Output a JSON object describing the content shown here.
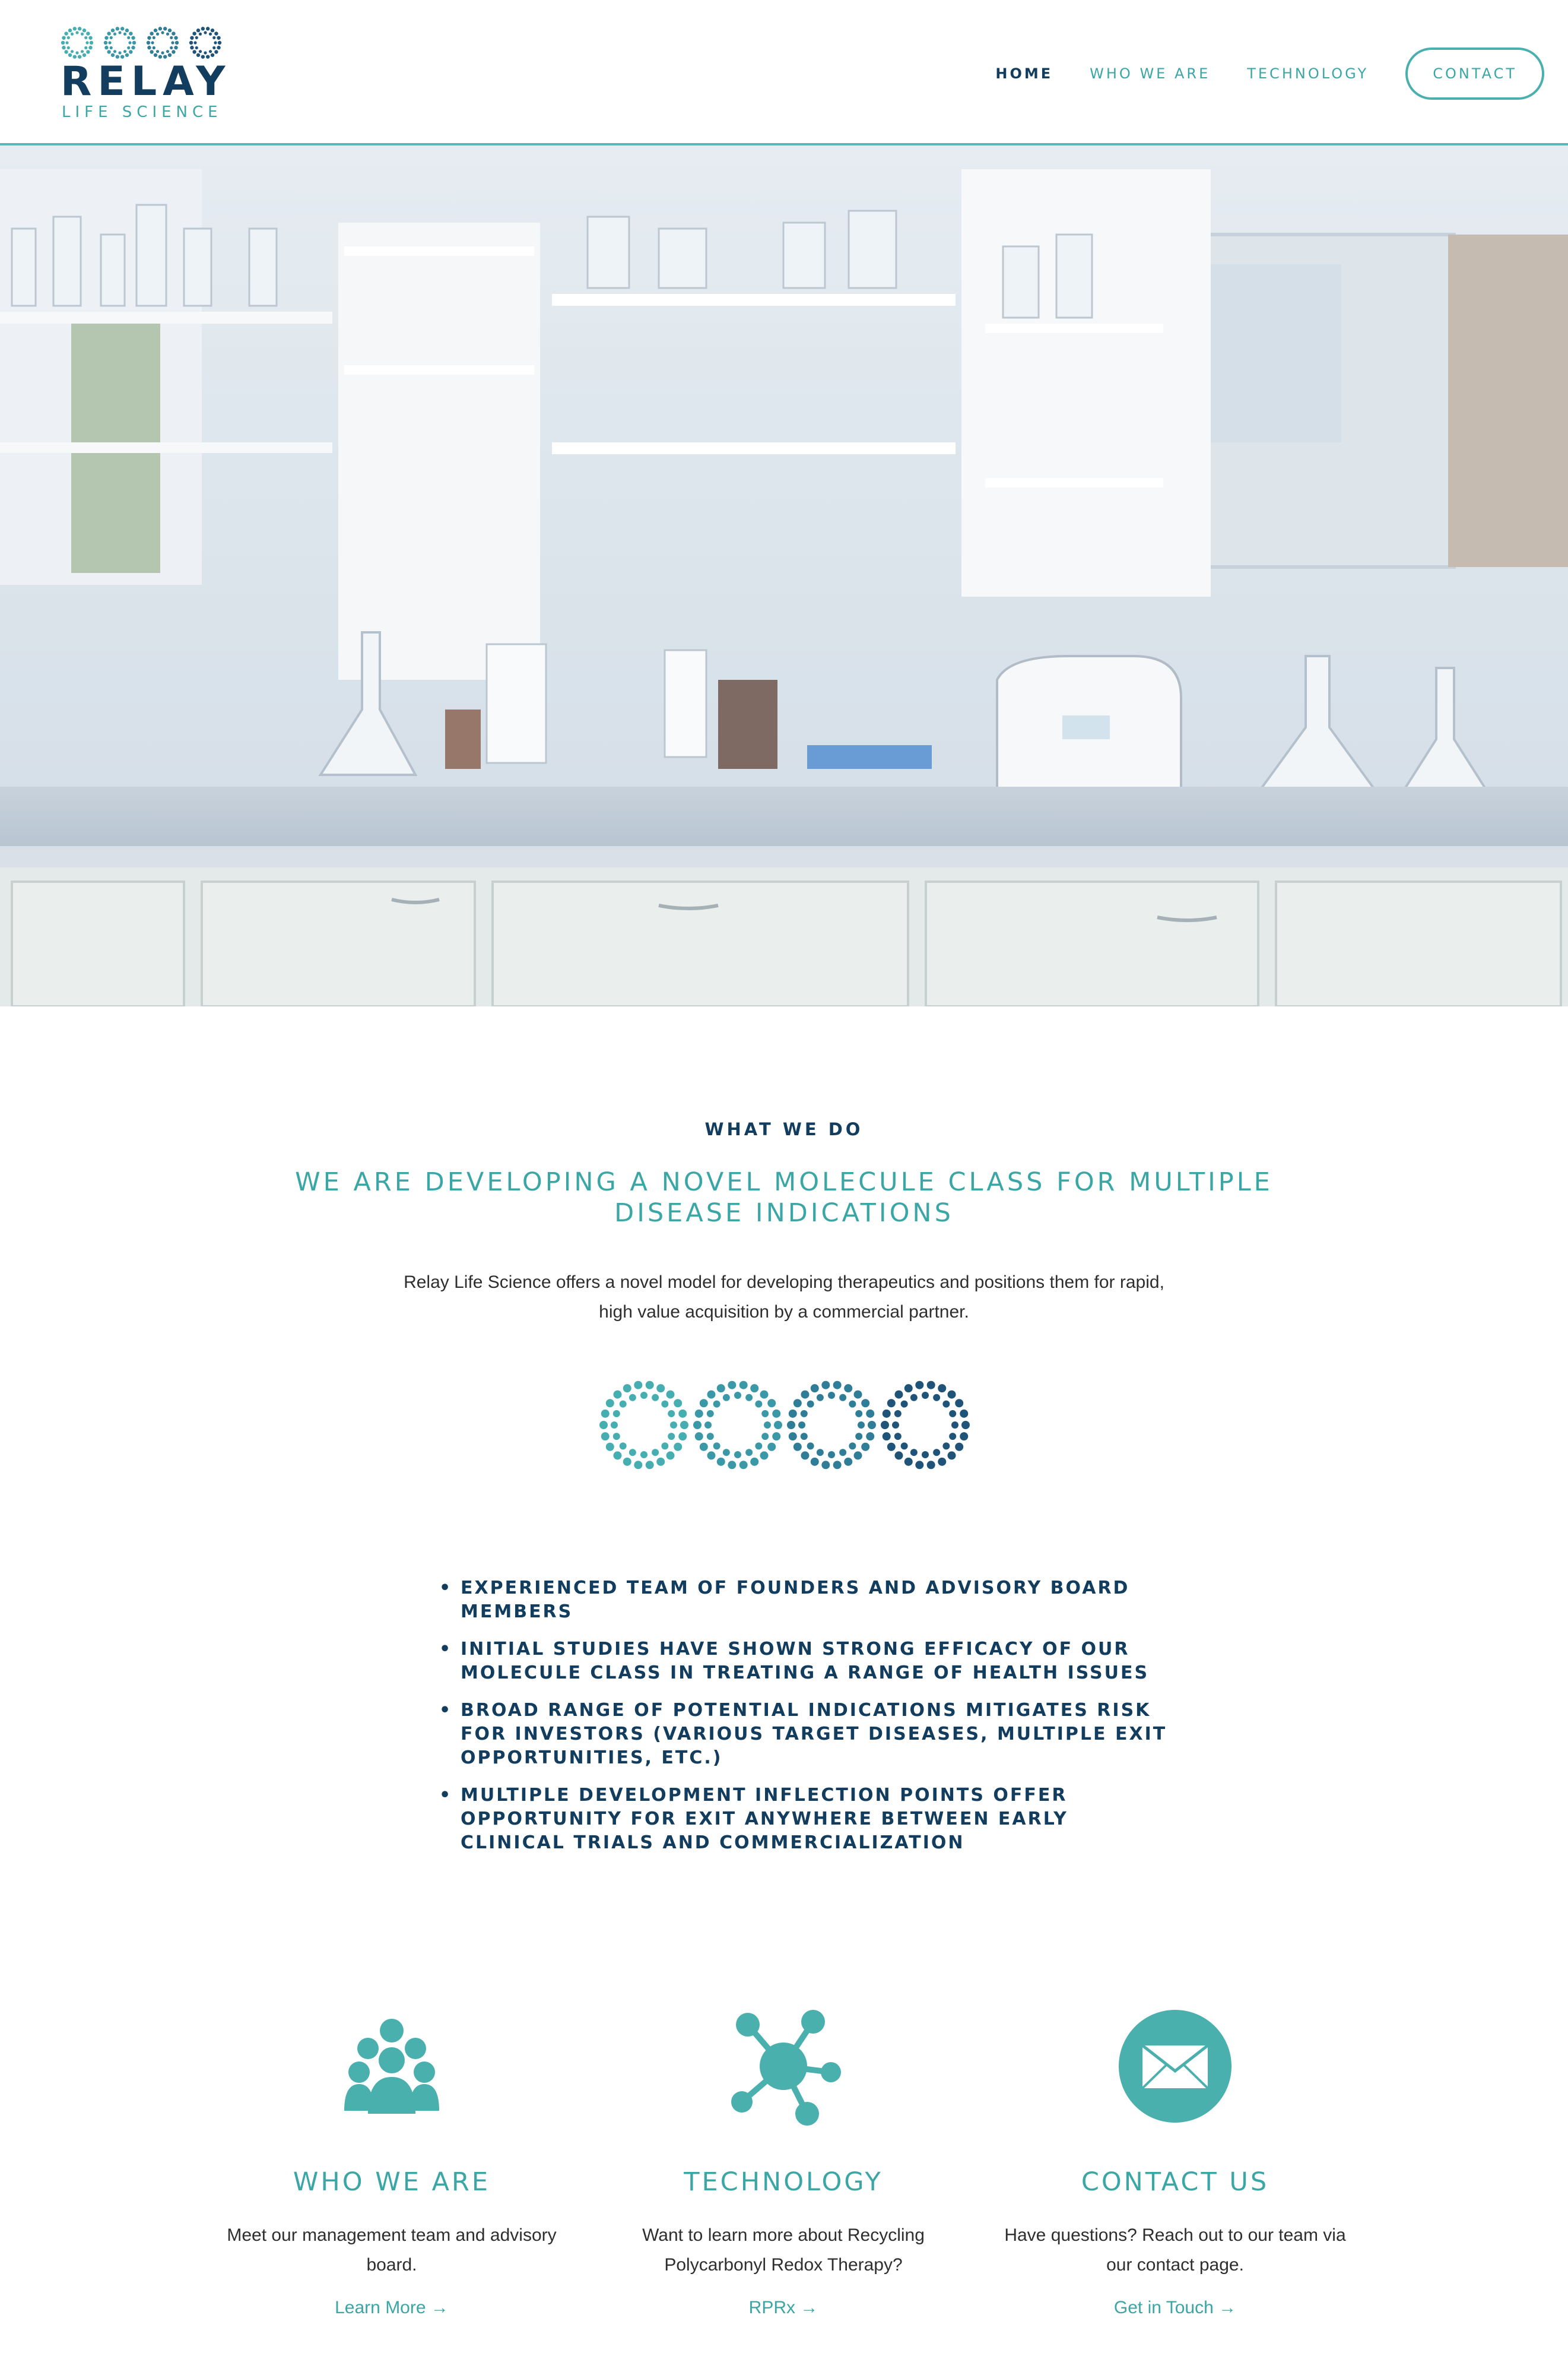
{
  "header": {
    "logo": {
      "word": "RELAY",
      "sub": "LIFE SCIENCE"
    },
    "nav": [
      {
        "label": "HOME",
        "active": true
      },
      {
        "label": "WHO WE ARE"
      },
      {
        "label": "TECHNOLOGY"
      }
    ],
    "contact_label": "CONTACT"
  },
  "hero": {
    "image": "laboratory-bench-photo"
  },
  "what_we_do": {
    "eyebrow": "WHAT WE DO",
    "headline": "WE ARE DEVELOPING A NOVEL MOLECULE CLASS FOR MULTIPLE DISEASE INDICATIONS",
    "lead": "Relay Life Science offers a novel model for developing therapeutics and positions them for rapid, high value acquisition by a commercial partner.",
    "bullets": [
      "EXPERIENCED TEAM OF FOUNDERS AND ADVISORY BOARD MEMBERS",
      "INITIAL STUDIES HAVE SHOWN STRONG EFFICACY OF OUR MOLECULE CLASS IN TREATING A RANGE OF HEALTH ISSUES",
      "BROAD RANGE OF POTENTIAL INDICATIONS MITIGATES RISK FOR INVESTORS (VARIOUS TARGET DISEASES, MULTIPLE EXIT OPPORTUNITIES, ETC.)",
      "MULTIPLE DEVELOPMENT INFLECTION POINTS OFFER OPPORTUNITY FOR EXIT ANYWHERE BETWEEN EARLY CLINICAL TRIALS AND COMMERCIALIZATION"
    ]
  },
  "cards": [
    {
      "icon": "people-group-icon",
      "title": "WHO WE ARE",
      "text": "Meet our management team and advisory board.",
      "link": "Learn More →"
    },
    {
      "icon": "molecule-icon",
      "title": "TECHNOLOGY",
      "text": "Want to learn more about Recycling Polycarbonyl Redox Therapy?",
      "link": "RPRx →"
    },
    {
      "icon": "envelope-icon",
      "title": "CONTACT US",
      "text": "Have questions? Reach out to our team via our contact page.",
      "link": "Get in Touch →"
    }
  ],
  "colors": {
    "teal": "#3aa6a6",
    "navy": "#123d5e",
    "ring_blue": "#2f7d97"
  }
}
